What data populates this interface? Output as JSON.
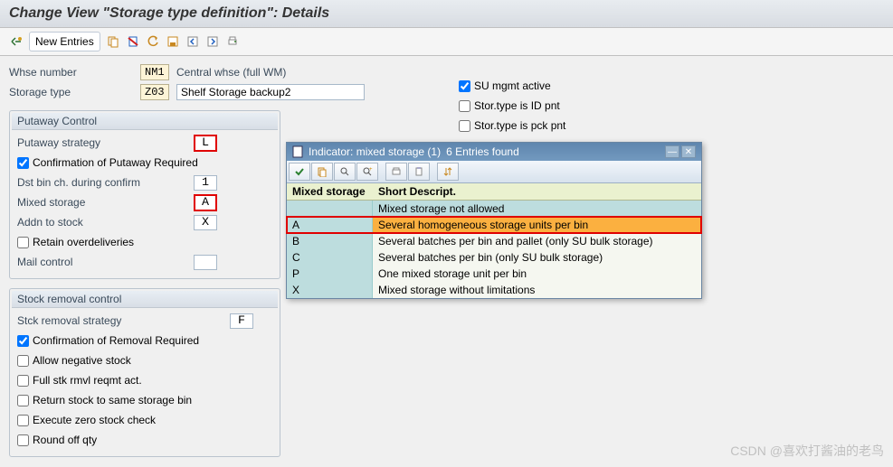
{
  "title": "Change View \"Storage type definition\": Details",
  "toolbar": {
    "new_entries": "New Entries"
  },
  "header": {
    "whse_label": "Whse number",
    "whse_value": "NM1",
    "whse_desc": "Central whse (full WM)",
    "storage_type_label": "Storage type",
    "storage_type_value": "Z03",
    "storage_type_desc": "Shelf Storage backup2",
    "su_mgmt": "SU mgmt active",
    "stor_id_pnt": "Stor.type is ID pnt",
    "stor_pck_pnt": "Stor.type is pck pnt"
  },
  "putaway": {
    "title": "Putaway Control",
    "strategy_label": "Putaway strategy",
    "strategy_value": "L",
    "confirm_label": "Confirmation of Putaway Required",
    "dst_bin_label": "Dst bin ch. during confirm",
    "dst_bin_value": "1",
    "mixed_label": "Mixed storage",
    "mixed_value": "A",
    "addn_label": "Addn to stock",
    "addn_value": "X",
    "retain_label": "Retain overdeliveries",
    "mail_label": "Mail control"
  },
  "removal": {
    "title": "Stock removal control",
    "strategy_label": "Stck removal strategy",
    "strategy_value": "F",
    "confirm_label": "Confirmation of Removal Required",
    "neg_label": "Allow negative stock",
    "full_label": "Full stk rmvl reqmt act.",
    "return_label": "Return stock to same storage bin",
    "zero_label": "Execute zero stock check",
    "round_label": "Round off qty"
  },
  "popup": {
    "title_left": "Indicator: mixed storage (1)",
    "title_right": "6 Entries found",
    "col1": "Mixed storage",
    "col2": "Short Descript.",
    "rows": [
      {
        "code": "",
        "desc": "Mixed storage not allowed"
      },
      {
        "code": "A",
        "desc": "Several homogeneous storage units per bin"
      },
      {
        "code": "B",
        "desc": "Several batches per bin and pallet (only SU bulk storage)"
      },
      {
        "code": "C",
        "desc": "Several batches per bin (only SU bulk storage)"
      },
      {
        "code": "P",
        "desc": "One mixed storage unit per bin"
      },
      {
        "code": "X",
        "desc": "Mixed storage without limitations"
      }
    ]
  },
  "watermark": "CSDN @喜欢打酱油的老鸟"
}
